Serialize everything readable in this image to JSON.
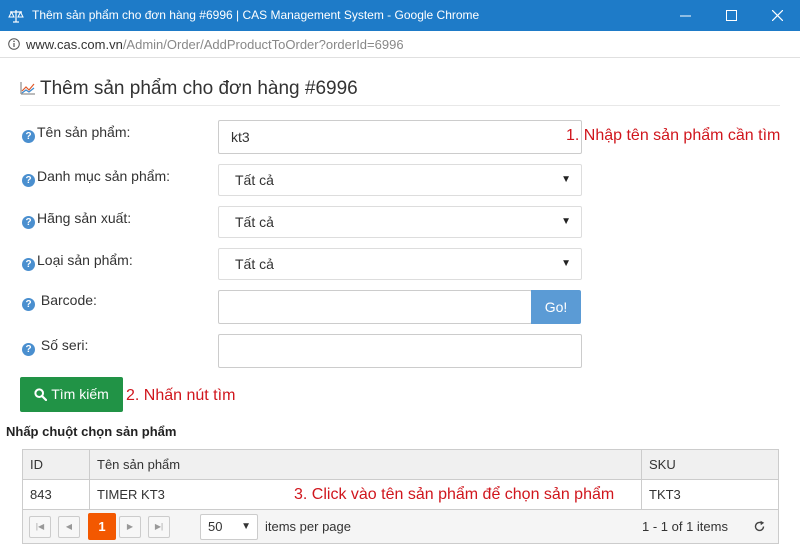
{
  "window": {
    "title": "Thêm sản phẩm cho đơn hàng #6996 | CAS Management System - Google Chrome",
    "minimize_icon": "minimize-icon",
    "maximize_icon": "maximize-icon",
    "close_icon": "close-icon"
  },
  "address": {
    "domain": "www.cas.com.vn",
    "path": "/Admin/Order/AddProductToOrder?orderId=6996"
  },
  "page": {
    "title": "Thêm sản phẩm cho đơn hàng #6996"
  },
  "form": {
    "product_name": {
      "label": "Tên sản phẩm:",
      "value": "kt3"
    },
    "category": {
      "label": "Danh mục sản phẩm:",
      "selected": "Tất cả"
    },
    "manufacturer": {
      "label": "Hãng sản xuất:",
      "selected": "Tất cả"
    },
    "product_type": {
      "label": "Loại sản phẩm:",
      "selected": "Tất cả"
    },
    "barcode": {
      "label": "Barcode:",
      "value": "",
      "go_label": "Go!"
    },
    "serial": {
      "label": "Số seri:",
      "value": ""
    },
    "search_label": "Tìm kiếm"
  },
  "annotations": {
    "step1": "1. Nhập tên sản phẩm cần tìm",
    "step2": "2. Nhấn nút tìm",
    "step3": "3. Click vào tên sản phẩm để chọn sản phẩm"
  },
  "grid": {
    "title": "Nhấp chuột chọn sản phẩm",
    "columns": [
      "ID",
      "Tên sản phẩm",
      "SKU"
    ],
    "rows": [
      {
        "id": "843",
        "name": "TIMER KT3",
        "sku": "TKT3"
      }
    ],
    "pager": {
      "current_page": "1",
      "page_size": "50",
      "items_per_page_label": "items per page",
      "info": "1 - 1 of 1 items"
    }
  },
  "colors": {
    "titlebar": "#1e7bc8",
    "search_button": "#219346",
    "go_button": "#5b9bd5",
    "active_page": "#f35800",
    "annotation": "#d0161d"
  }
}
